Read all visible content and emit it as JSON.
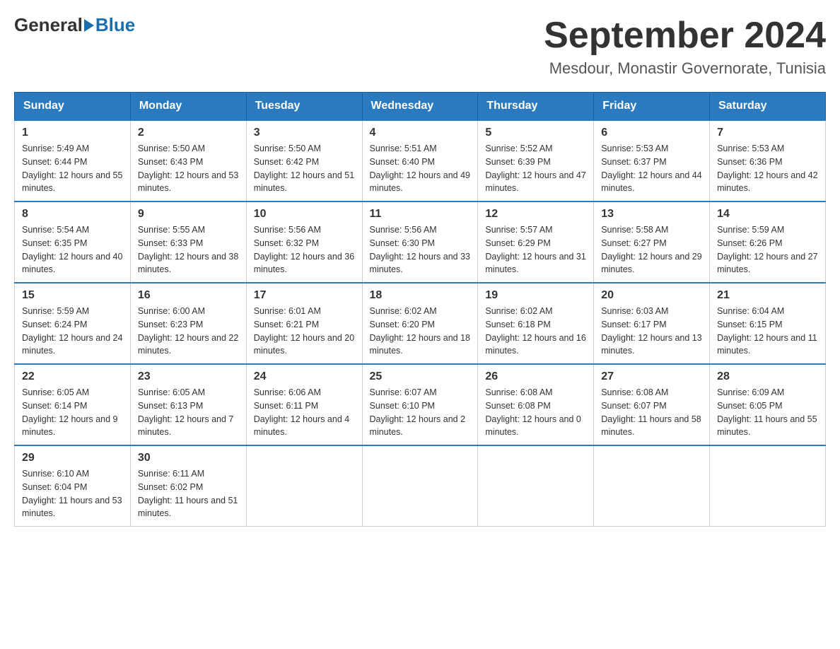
{
  "header": {
    "logo_general": "General",
    "logo_blue": "Blue",
    "month_title": "September 2024",
    "location": "Mesdour, Monastir Governorate, Tunisia"
  },
  "weekdays": [
    "Sunday",
    "Monday",
    "Tuesday",
    "Wednesday",
    "Thursday",
    "Friday",
    "Saturday"
  ],
  "weeks": [
    [
      {
        "day": "1",
        "sunrise": "5:49 AM",
        "sunset": "6:44 PM",
        "daylight": "12 hours and 55 minutes."
      },
      {
        "day": "2",
        "sunrise": "5:50 AM",
        "sunset": "6:43 PM",
        "daylight": "12 hours and 53 minutes."
      },
      {
        "day": "3",
        "sunrise": "5:50 AM",
        "sunset": "6:42 PM",
        "daylight": "12 hours and 51 minutes."
      },
      {
        "day": "4",
        "sunrise": "5:51 AM",
        "sunset": "6:40 PM",
        "daylight": "12 hours and 49 minutes."
      },
      {
        "day": "5",
        "sunrise": "5:52 AM",
        "sunset": "6:39 PM",
        "daylight": "12 hours and 47 minutes."
      },
      {
        "day": "6",
        "sunrise": "5:53 AM",
        "sunset": "6:37 PM",
        "daylight": "12 hours and 44 minutes."
      },
      {
        "day": "7",
        "sunrise": "5:53 AM",
        "sunset": "6:36 PM",
        "daylight": "12 hours and 42 minutes."
      }
    ],
    [
      {
        "day": "8",
        "sunrise": "5:54 AM",
        "sunset": "6:35 PM",
        "daylight": "12 hours and 40 minutes."
      },
      {
        "day": "9",
        "sunrise": "5:55 AM",
        "sunset": "6:33 PM",
        "daylight": "12 hours and 38 minutes."
      },
      {
        "day": "10",
        "sunrise": "5:56 AM",
        "sunset": "6:32 PM",
        "daylight": "12 hours and 36 minutes."
      },
      {
        "day": "11",
        "sunrise": "5:56 AM",
        "sunset": "6:30 PM",
        "daylight": "12 hours and 33 minutes."
      },
      {
        "day": "12",
        "sunrise": "5:57 AM",
        "sunset": "6:29 PM",
        "daylight": "12 hours and 31 minutes."
      },
      {
        "day": "13",
        "sunrise": "5:58 AM",
        "sunset": "6:27 PM",
        "daylight": "12 hours and 29 minutes."
      },
      {
        "day": "14",
        "sunrise": "5:59 AM",
        "sunset": "6:26 PM",
        "daylight": "12 hours and 27 minutes."
      }
    ],
    [
      {
        "day": "15",
        "sunrise": "5:59 AM",
        "sunset": "6:24 PM",
        "daylight": "12 hours and 24 minutes."
      },
      {
        "day": "16",
        "sunrise": "6:00 AM",
        "sunset": "6:23 PM",
        "daylight": "12 hours and 22 minutes."
      },
      {
        "day": "17",
        "sunrise": "6:01 AM",
        "sunset": "6:21 PM",
        "daylight": "12 hours and 20 minutes."
      },
      {
        "day": "18",
        "sunrise": "6:02 AM",
        "sunset": "6:20 PM",
        "daylight": "12 hours and 18 minutes."
      },
      {
        "day": "19",
        "sunrise": "6:02 AM",
        "sunset": "6:18 PM",
        "daylight": "12 hours and 16 minutes."
      },
      {
        "day": "20",
        "sunrise": "6:03 AM",
        "sunset": "6:17 PM",
        "daylight": "12 hours and 13 minutes."
      },
      {
        "day": "21",
        "sunrise": "6:04 AM",
        "sunset": "6:15 PM",
        "daylight": "12 hours and 11 minutes."
      }
    ],
    [
      {
        "day": "22",
        "sunrise": "6:05 AM",
        "sunset": "6:14 PM",
        "daylight": "12 hours and 9 minutes."
      },
      {
        "day": "23",
        "sunrise": "6:05 AM",
        "sunset": "6:13 PM",
        "daylight": "12 hours and 7 minutes."
      },
      {
        "day": "24",
        "sunrise": "6:06 AM",
        "sunset": "6:11 PM",
        "daylight": "12 hours and 4 minutes."
      },
      {
        "day": "25",
        "sunrise": "6:07 AM",
        "sunset": "6:10 PM",
        "daylight": "12 hours and 2 minutes."
      },
      {
        "day": "26",
        "sunrise": "6:08 AM",
        "sunset": "6:08 PM",
        "daylight": "12 hours and 0 minutes."
      },
      {
        "day": "27",
        "sunrise": "6:08 AM",
        "sunset": "6:07 PM",
        "daylight": "11 hours and 58 minutes."
      },
      {
        "day": "28",
        "sunrise": "6:09 AM",
        "sunset": "6:05 PM",
        "daylight": "11 hours and 55 minutes."
      }
    ],
    [
      {
        "day": "29",
        "sunrise": "6:10 AM",
        "sunset": "6:04 PM",
        "daylight": "11 hours and 53 minutes."
      },
      {
        "day": "30",
        "sunrise": "6:11 AM",
        "sunset": "6:02 PM",
        "daylight": "11 hours and 51 minutes."
      },
      null,
      null,
      null,
      null,
      null
    ]
  ]
}
